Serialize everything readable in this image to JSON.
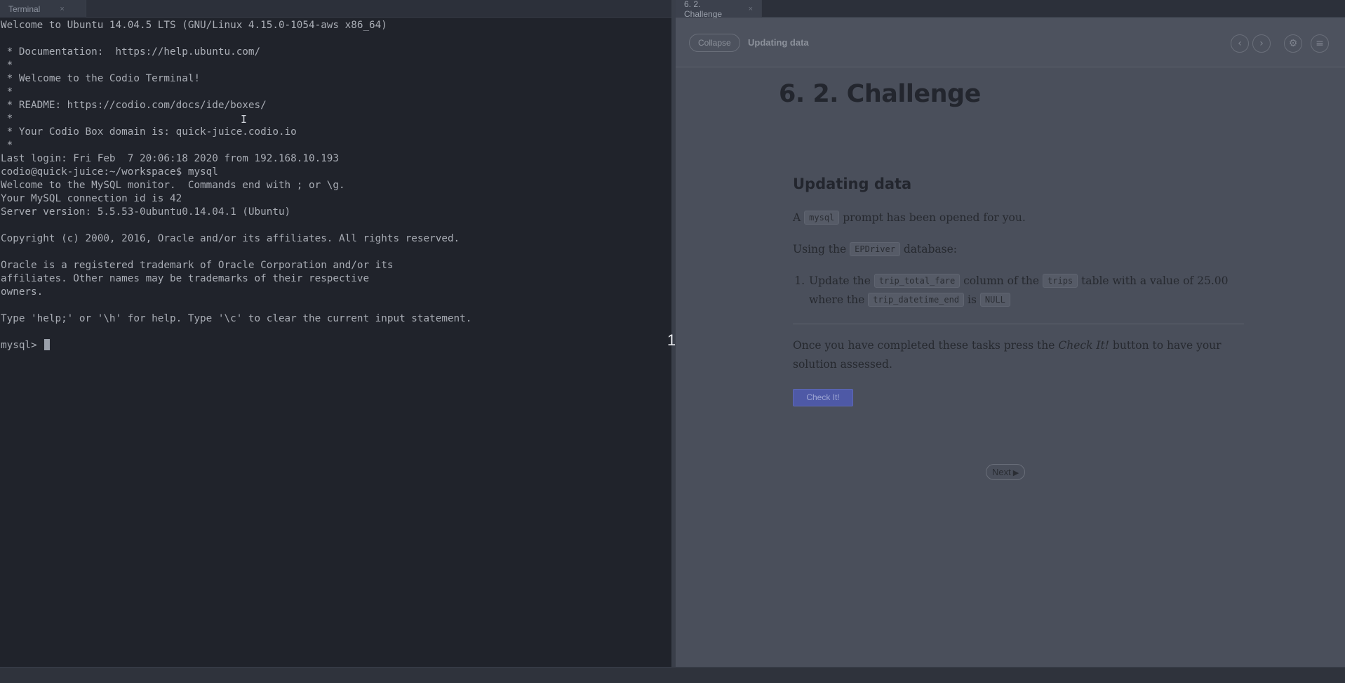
{
  "left_tab": {
    "label": "Terminal",
    "close": "×"
  },
  "right_tab": {
    "label": "6. 2. Challenge",
    "close": "×"
  },
  "terminal": {
    "lines": [
      "Welcome to Ubuntu 14.04.5 LTS (GNU/Linux 4.15.0-1054-aws x86_64)",
      "",
      " * Documentation:  https://help.ubuntu.com/",
      " *",
      " * Welcome to the Codio Terminal!",
      " *",
      " * README: https://codio.com/docs/ide/boxes/",
      " *",
      " * Your Codio Box domain is: quick-juice.codio.io",
      " *",
      "Last login: Fri Feb  7 20:06:18 2020 from 192.168.10.193",
      "codio@quick-juice:~/workspace$ mysql",
      "Welcome to the MySQL monitor.  Commands end with ; or \\g.",
      "Your MySQL connection id is 42",
      "Server version: 5.5.53-0ubuntu0.14.04.1 (Ubuntu)",
      "",
      "Copyright (c) 2000, 2016, Oracle and/or its affiliates. All rights reserved.",
      "",
      "Oracle is a registered trademark of Oracle Corporation and/or its",
      "affiliates. Other names may be trademarks of their respective",
      "owners.",
      "",
      "Type 'help;' or '\\h' for help. Type '\\c' to clear the current input statement.",
      ""
    ],
    "prompt": "mysql> "
  },
  "splitter": {
    "label": "1"
  },
  "guide": {
    "collapse_label": "Collapse",
    "header_title": "Updating data",
    "icons": [
      "chevron-left-icon",
      "chevron-right-icon",
      "gear-icon",
      "menu-icon"
    ],
    "page_title": "6. 2. Challenge",
    "section_title": "Updating data",
    "p1": {
      "before": "A",
      "code": "mysql",
      "after": "prompt has been opened for you."
    },
    "p2": {
      "before": "Using the",
      "code": "EPDriver",
      "after": "database:"
    },
    "task": {
      "number": "1.",
      "t1": "Update the",
      "c1": "trip_total_fare",
      "t2": "column of the",
      "c2": "trips",
      "t3": "table with a value of 25.00",
      "t4": "where the",
      "c3": "trip_datetime_end",
      "t5": "is",
      "c4": "NULL"
    },
    "p3": {
      "before": "Once you have completed these tasks press the",
      "emph": "Check It!",
      "after": "button to have your solution assessed."
    },
    "check_label": "Check It!",
    "next_label": "Next"
  },
  "colors": {
    "terminal_bg": "#20232b",
    "guide_bg": "#4a4f5b",
    "check_button": "#4e59a6"
  }
}
